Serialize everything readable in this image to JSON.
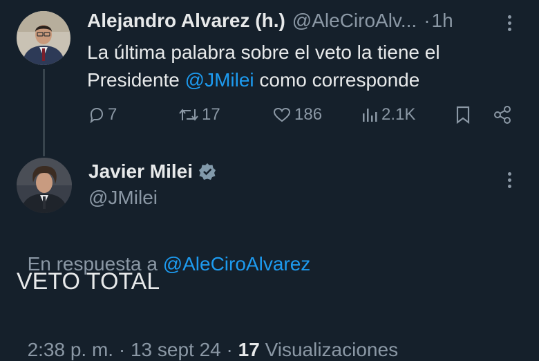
{
  "reply_tweet": {
    "author_name": "Alejandro Alvarez (h.)",
    "author_handle": "@AleCiroAlv...",
    "dot": "·",
    "time": "1h",
    "text_line1": "La última palabra sobre el veto la tiene el",
    "text_line2_start": "Presidente ",
    "mention": "@JMilei",
    "text_line2_end": " como corresponde",
    "replies": "7",
    "retweets": "17",
    "likes": "186",
    "views": "2.1K"
  },
  "main_tweet": {
    "author_name": "Javier Milei",
    "author_handle": "@JMilei",
    "reply_prefix": "En respuesta a ",
    "reply_to": "@AleCiroAlvarez",
    "text": "VETO TOTAL",
    "time": "2:38 p. m.",
    "sep1": "·",
    "date": "13 sept 24",
    "sep2": "·",
    "views_count": "17",
    "views_label": " Visualizaciones"
  },
  "colors": {
    "background": "#15202b",
    "text": "#e7e9ea",
    "muted": "#8b98a5",
    "link": "#1d9bf0",
    "verified": "#829aab"
  },
  "icons": {
    "reply": "reply-icon",
    "retweet": "retweet-icon",
    "like": "heart-icon",
    "views": "views-icon",
    "bookmark": "bookmark-icon",
    "share": "share-icon",
    "verified": "verified-badge-icon",
    "more": "more-options-icon"
  }
}
